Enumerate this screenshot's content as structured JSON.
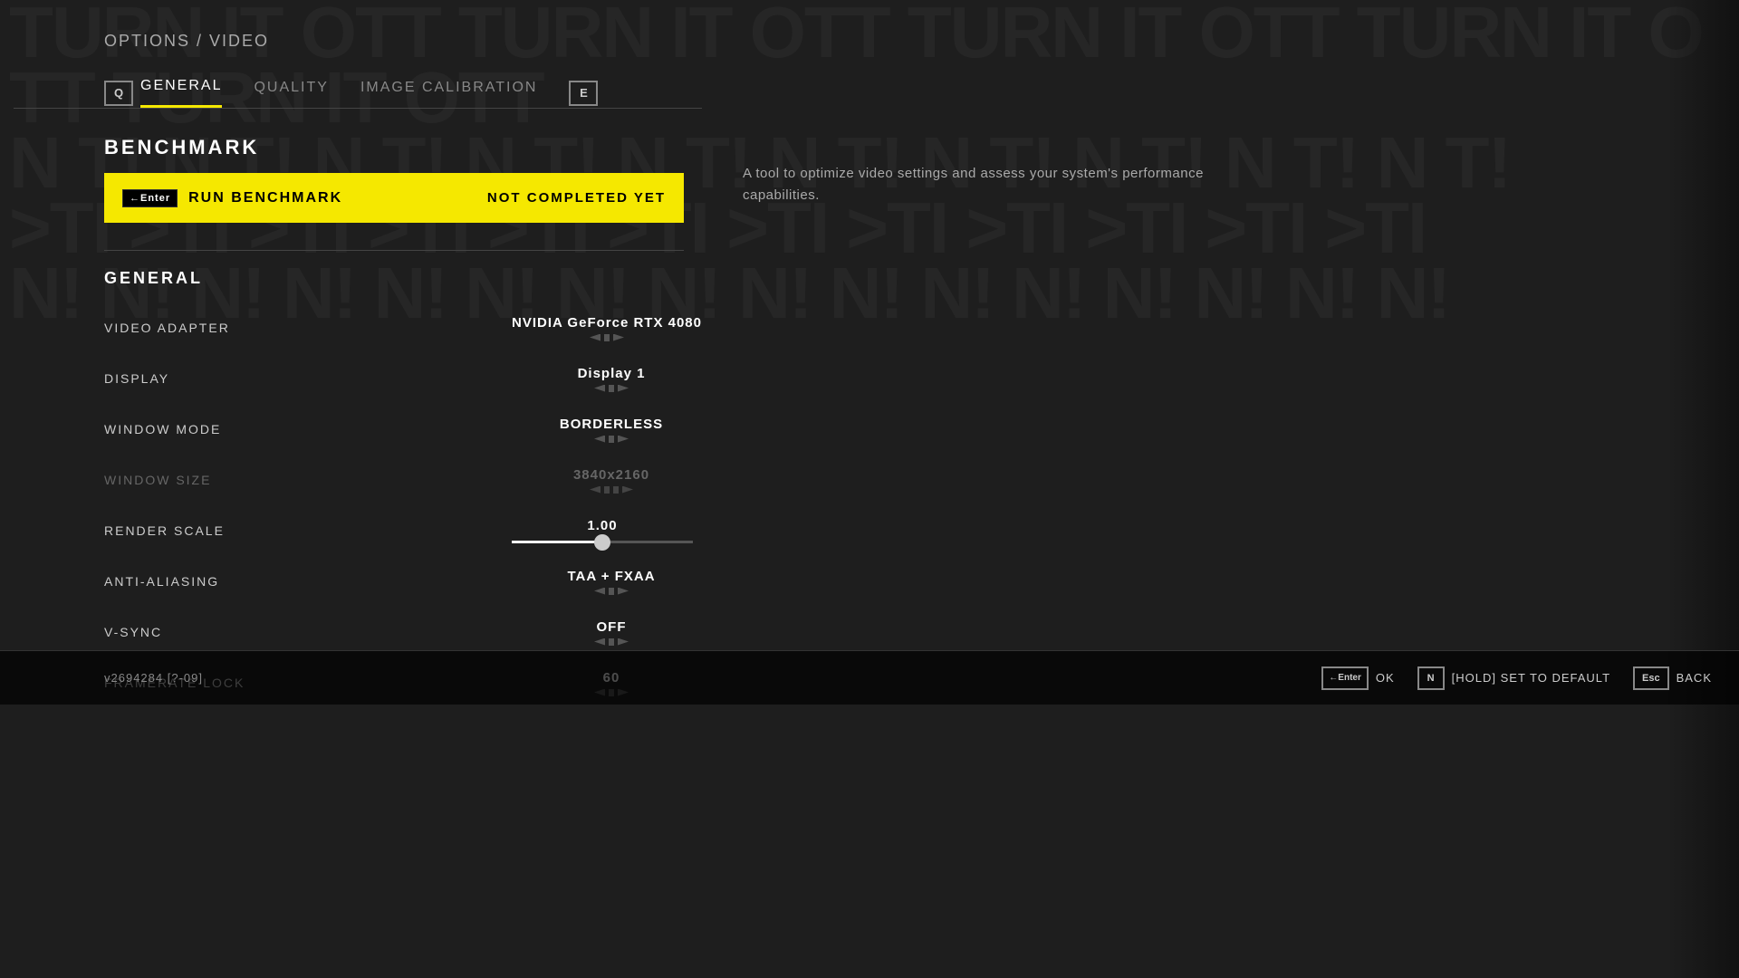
{
  "header": {
    "breadcrumb": "OPTIONS / ",
    "breadcrumb_current": "VIDEO"
  },
  "tabs": {
    "q_key": "Q",
    "e_key": "E",
    "items": [
      {
        "id": "general",
        "label": "GENERAL",
        "active": true
      },
      {
        "id": "quality",
        "label": "QUALITY",
        "active": false
      },
      {
        "id": "image_calibration",
        "label": "IMAGE CALIBRATION",
        "active": false
      }
    ]
  },
  "benchmark": {
    "section_title": "BENCHMARK",
    "enter_key_label": "←Enter",
    "run_label": "RUN BENCHMARK",
    "status": "NOT COMPLETED YET",
    "description": "A tool to optimize video settings and assess your system's performance capabilities."
  },
  "general_section": {
    "title": "GENERAL",
    "settings": [
      {
        "label": "VIDEO ADAPTER",
        "value": "NVIDIA GeForce RTX 4080",
        "dimmed": false,
        "type": "selector"
      },
      {
        "label": "DISPLAY",
        "value": "Display 1",
        "dimmed": false,
        "type": "selector"
      },
      {
        "label": "WINDOW MODE",
        "value": "BORDERLESS",
        "dimmed": false,
        "type": "selector"
      },
      {
        "label": "WINDOW SIZE",
        "value": "3840x2160",
        "dimmed": true,
        "type": "selector"
      },
      {
        "label": "RENDER SCALE",
        "value": "1.00",
        "dimmed": false,
        "type": "slider",
        "slider_percent": 50
      },
      {
        "label": "ANTI-ALIASING",
        "value": "TAA + FXAA",
        "dimmed": false,
        "type": "selector"
      },
      {
        "label": "V-SYNC",
        "value": "OFF",
        "dimmed": false,
        "type": "selector"
      },
      {
        "label": "FRAMERATE LOCK",
        "value": "60",
        "dimmed": false,
        "type": "selector"
      }
    ]
  },
  "bottom": {
    "version": "v2694284 [?-09]",
    "controls": [
      {
        "key": "←Enter",
        "label": "OK"
      },
      {
        "key": "N",
        "label": "[HOLD] SET TO DEFAULT"
      },
      {
        "key": "Esc",
        "label": "BACK"
      }
    ]
  }
}
